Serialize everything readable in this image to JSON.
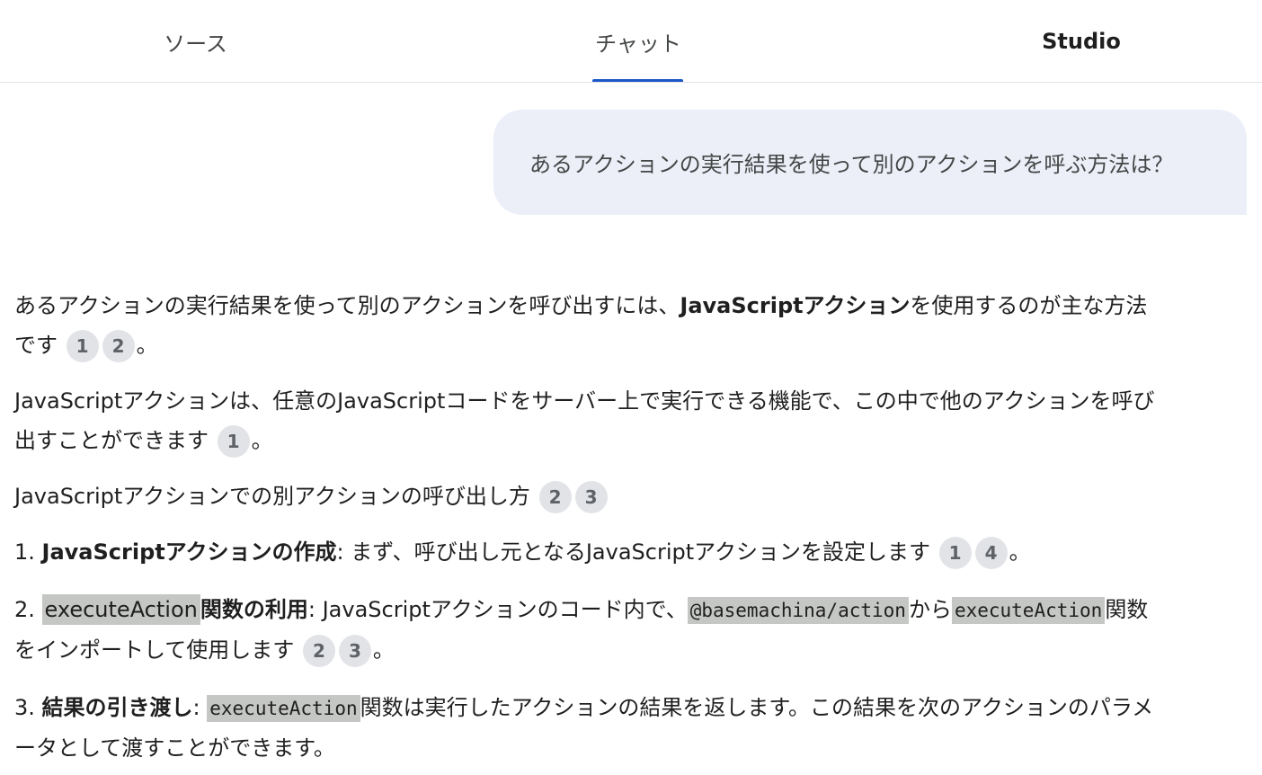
{
  "tabs": {
    "sources": "ソース",
    "chat": "チャット",
    "studio": "Studio",
    "active": "chat"
  },
  "user_message": "あるアクションの実行結果を使って別のアクションを呼ぶ方法は？",
  "answer": {
    "p1": {
      "text_a": "あるアクションの実行結果を使って別のアクションを呼び出すには、",
      "bold": "JavaScriptアクション",
      "text_b": "を使用するのが主な方法です",
      "cites": [
        "1",
        "2"
      ],
      "end": "。"
    },
    "p2": {
      "text": "JavaScriptアクションは、任意のJavaScriptコードをサーバー上で実行できる機能で、この中で他のアクションを呼び出すことができます",
      "cites": [
        "1"
      ],
      "end": "。"
    },
    "p3": {
      "text": "JavaScriptアクションでの別アクションの呼び出し方",
      "cites": [
        "2",
        "3"
      ]
    },
    "step1": {
      "num": "1. ",
      "bold": "JavaScriptアクションの作成",
      "text": ": まず、呼び出し元となるJavaScriptアクションを設定します",
      "cites": [
        "1",
        "4"
      ],
      "end": "。"
    },
    "step2": {
      "num": "2. ",
      "highlight": "executeAction",
      "bold": "関数の利用",
      "text_a": ": JavaScriptアクションのコード内で、",
      "code1": "@basemachina/action",
      "text_b": "から",
      "code2": "executeAction",
      "text_c": "関数をインポートして使用します",
      "cites": [
        "2",
        "3"
      ],
      "end": "。"
    },
    "step3": {
      "num": "3. ",
      "bold": "結果の引き渡し",
      "text_a": ": ",
      "code": "executeAction",
      "text_b": "関数は実行したアクションの結果を返します。この結果を次のアクションのパラメータとして渡すことができます。"
    }
  },
  "colors": {
    "tab_underline": "#1a56c8",
    "user_bubble": "#eceff8",
    "citation_bg": "#e1e3e6",
    "code_bg": "#c5c7c4"
  }
}
